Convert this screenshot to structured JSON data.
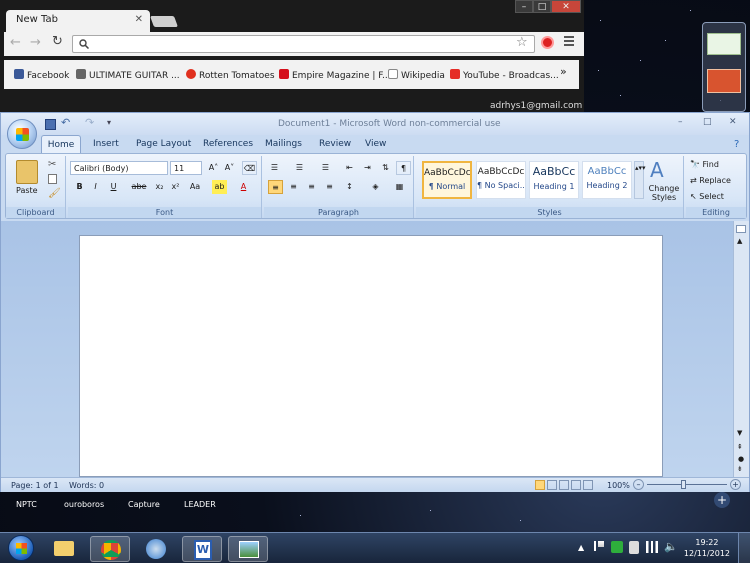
{
  "browser": {
    "tab_title": "New Tab",
    "tab_close": "✕",
    "bookmarks": [
      "Facebook",
      "ULTIMATE GUITAR ...",
      "Rotten Tomatoes",
      "Empire Magazine | F...",
      "Wikipedia",
      "YouTube - Broadcas..."
    ],
    "bookmarks_more": "»",
    "account": "adrhys1@gmail.com"
  },
  "word": {
    "title": "Document1  -  Microsoft Word non-commercial use",
    "tabs": [
      "Home",
      "Insert",
      "Page Layout",
      "References",
      "Mailings",
      "Review",
      "View"
    ],
    "font_name": "Calibri (Body)",
    "font_size": "11",
    "groups": {
      "clipboard": "Clipboard",
      "font": "Font",
      "paragraph": "Paragraph",
      "styles": "Styles",
      "editing": "Editing"
    },
    "paste_label": "Paste",
    "styles": [
      {
        "preview": "AaBbCcDc",
        "name": "¶ Normal"
      },
      {
        "preview": "AaBbCcDc",
        "name": "¶ No Spaci..."
      },
      {
        "preview": "AaBbCc",
        "name": "Heading 1"
      },
      {
        "preview": "AaBbCc",
        "name": "Heading 2"
      }
    ],
    "change_styles": "Change Styles",
    "find": "Find",
    "replace": "Replace",
    "select": "Select",
    "status_page": "Page: 1 of 1",
    "status_words": "Words: 0",
    "zoom": "100%",
    "font_btns": [
      "B",
      "I",
      "U",
      "abe",
      "x₂",
      "x²",
      "Aa"
    ]
  },
  "desktop_labels": [
    "NPTC",
    "ouroboros",
    "Capture",
    "LEADER"
  ],
  "clock": {
    "time": "19:22",
    "date": "12/11/2012"
  }
}
